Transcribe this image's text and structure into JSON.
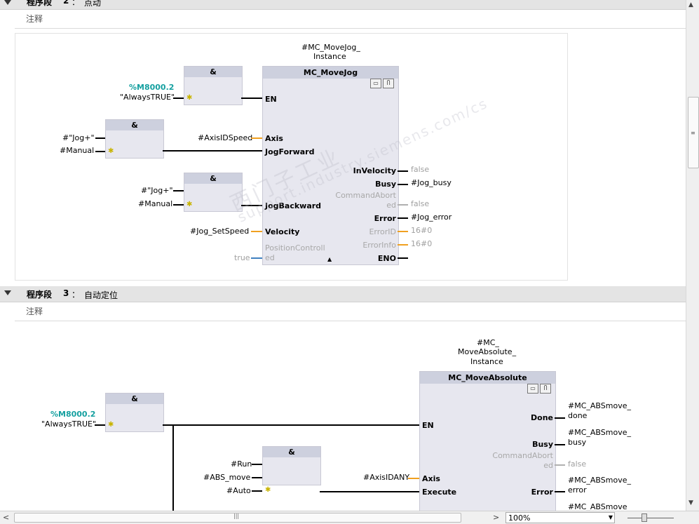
{
  "segment2": {
    "title": "程序段",
    "number": "2",
    "colon": "：",
    "name": "点动",
    "comment": "注释"
  },
  "segment3": {
    "title": "程序段",
    "number": "3",
    "colon": "：",
    "name": "自动定位",
    "comment": "注释"
  },
  "net2": {
    "instance_line1": "#MC_MoveJog_",
    "instance_line2": "Instance",
    "fb_title": "MC_MoveJog",
    "gate_symbol": "&",
    "addr": "%M8000.2",
    "always_true": "\"AlwaysTRUE\"",
    "jog_plus_a": "#\"Jog+\"",
    "manual_a": "#Manual",
    "axis_in": "#AxisIDSpeed",
    "jog_plus_b": "#\"Jog+\"",
    "manual_b": "#Manual",
    "velocity_in": "#Jog_SetSpeed",
    "position_in": "true",
    "pins": {
      "en": "EN",
      "axis": "Axis",
      "jogfwd": "JogForward",
      "invel": "InVelocity",
      "busy": "Busy",
      "cmdabort1": "CommandAbort",
      "cmdabort2": "ed",
      "jogbwd": "JogBackward",
      "error": "Error",
      "velocity": "Velocity",
      "errorid": "ErrorID",
      "errorinfo": "ErrorInfo",
      "posctrl1": "PositionControll",
      "posctrl2": "ed",
      "eno": "ENO"
    },
    "outs": {
      "invel": "false",
      "busy": "#Jog_busy",
      "cmdabort": "false",
      "error": "#Jog_error",
      "errorid": "16#0",
      "errorinfo": "16#0"
    }
  },
  "net3": {
    "instance_line1": "#MC_",
    "instance_line2": "MoveAbsolute_",
    "instance_line3": "Instance",
    "fb_title": "MC_MoveAbsolute",
    "gate_symbol": "&",
    "addr": "%M8000.2",
    "always_true": "\"AlwaysTRUE\"",
    "run": "#Run",
    "abs_move": "#ABS_move",
    "auto": "#Auto",
    "axis_in": "#AxisIDANY",
    "pins": {
      "en": "EN",
      "done": "Done",
      "busy": "Busy",
      "cmdabort1": "CommandAbort",
      "cmdabort2": "ed",
      "axis": "Axis",
      "execute": "Execute",
      "error": "Error"
    },
    "outs": {
      "done1": "#MC_ABSmove_",
      "done2": "done",
      "busy1": "#MC_ABSmove_",
      "busy2": "busy",
      "cmdabort": "false",
      "error1": "#MC_ABSmove_",
      "error2": "error",
      "next1": "#MC_ABSmove"
    }
  },
  "statusbar": {
    "zoom": "100%"
  },
  "icons": {
    "collapse": "triangle-down-icon",
    "fb_icon1": "monitor-icon",
    "fb_icon2": "stethoscope-icon",
    "star": "negation-star-icon"
  },
  "watermark": {
    "line1": "西门子工业",
    "line2": "support.industry.siemens.com/cs"
  },
  "colors": {
    "address": "#16a0a0",
    "orange_wire": "#f0a020",
    "blue_wire": "#4080c0",
    "gate_header": "#cdd0de"
  }
}
